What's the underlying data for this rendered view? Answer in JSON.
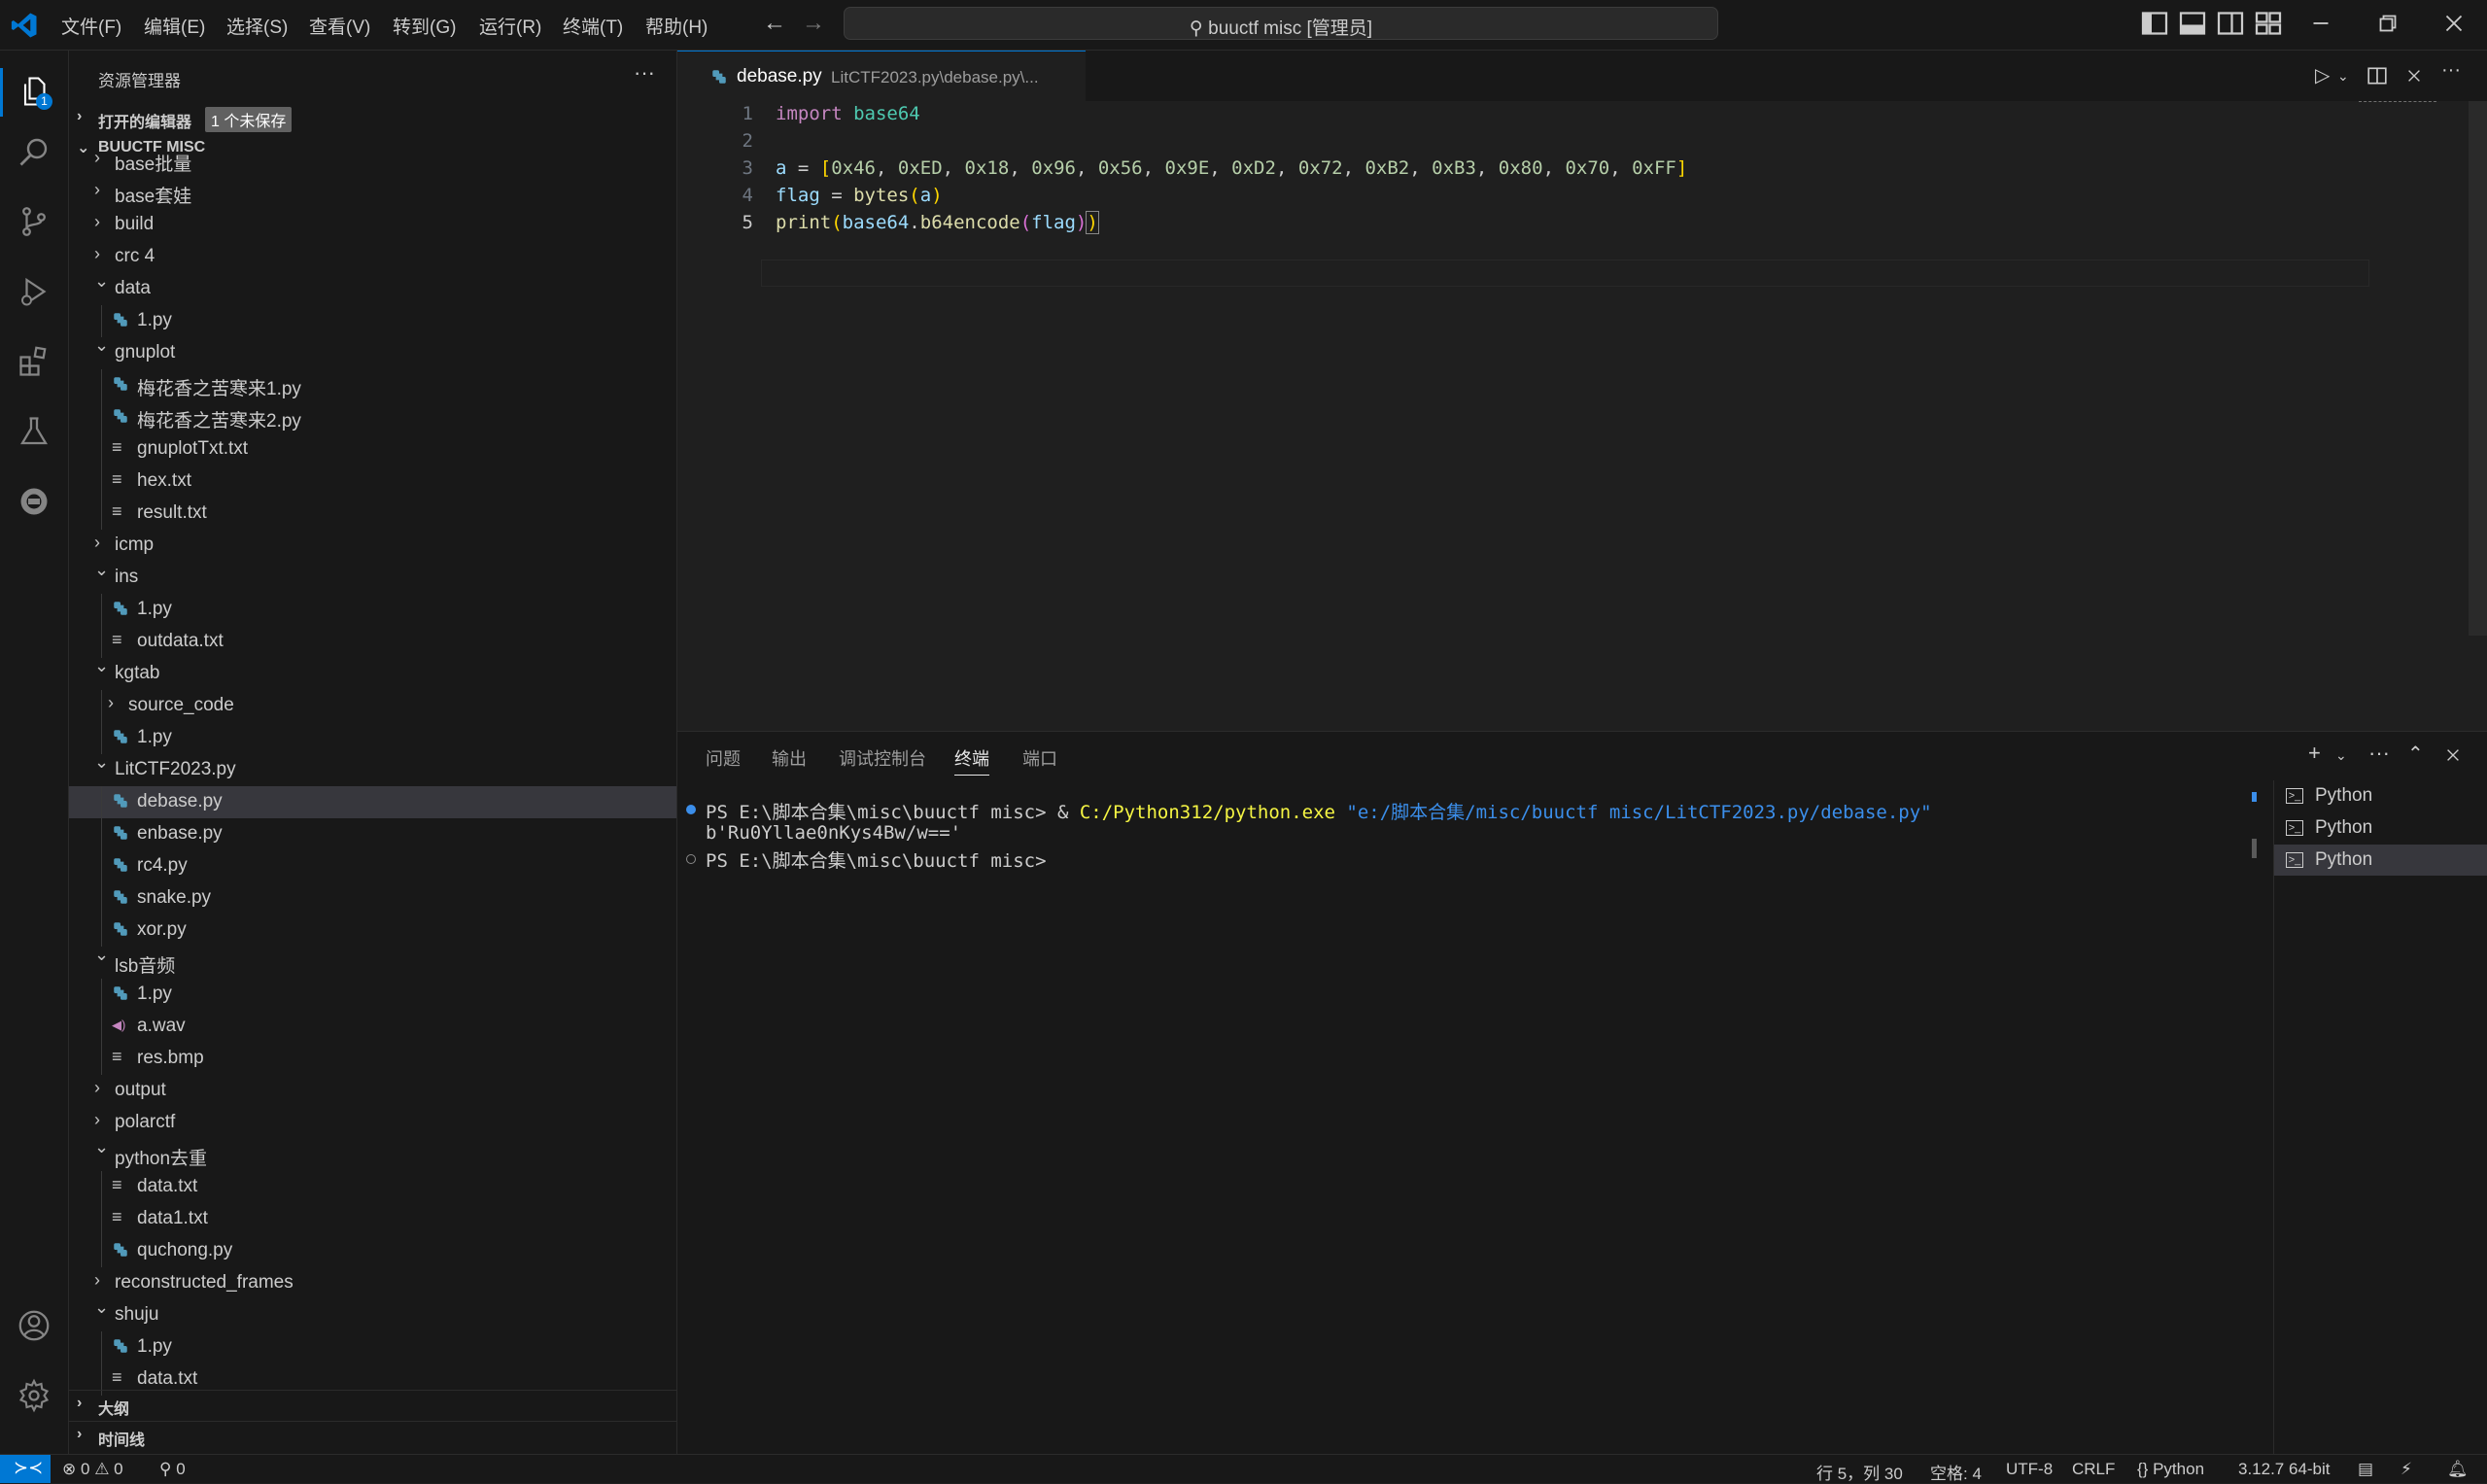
{
  "titlebar": {
    "menus": [
      "文件(F)",
      "编辑(E)",
      "选择(S)",
      "查看(V)",
      "转到(G)",
      "运行(R)",
      "终端(T)",
      "帮助(H)"
    ],
    "search_text": "buuctf misc [管理员]"
  },
  "activity": {
    "explorer_badge": "1"
  },
  "sidebar": {
    "title": "资源管理器",
    "more": "···",
    "open_editors_label": "打开的编辑器",
    "unsaved_badge": "1 个未保存",
    "folder_label": "BUUCTF MISC",
    "outline_label": "大纲",
    "timeline_label": "时间线",
    "tree": [
      {
        "name": "base批量",
        "type": "folder",
        "open": false,
        "depth": 0
      },
      {
        "name": "base套娃",
        "type": "folder",
        "open": false,
        "depth": 0
      },
      {
        "name": "build",
        "type": "folder",
        "open": false,
        "depth": 0
      },
      {
        "name": "crc 4",
        "type": "folder",
        "open": false,
        "depth": 0
      },
      {
        "name": "data",
        "type": "folder",
        "open": true,
        "depth": 0
      },
      {
        "name": "1.py",
        "type": "py",
        "depth": 1
      },
      {
        "name": "gnuplot",
        "type": "folder",
        "open": true,
        "depth": 0
      },
      {
        "name": "梅花香之苦寒来1.py",
        "type": "py",
        "depth": 1
      },
      {
        "name": "梅花香之苦寒来2.py",
        "type": "py",
        "depth": 1
      },
      {
        "name": "gnuplotTxt.txt",
        "type": "txt",
        "depth": 1
      },
      {
        "name": "hex.txt",
        "type": "txt",
        "depth": 1
      },
      {
        "name": "result.txt",
        "type": "txt",
        "depth": 1
      },
      {
        "name": "icmp",
        "type": "folder",
        "open": false,
        "depth": 0
      },
      {
        "name": "ins",
        "type": "folder",
        "open": true,
        "depth": 0
      },
      {
        "name": "1.py",
        "type": "py",
        "depth": 1
      },
      {
        "name": "outdata.txt",
        "type": "txt",
        "depth": 1
      },
      {
        "name": "kgtab",
        "type": "folder",
        "open": true,
        "depth": 0
      },
      {
        "name": "source_code",
        "type": "folder",
        "open": false,
        "depth": 1
      },
      {
        "name": "1.py",
        "type": "py",
        "depth": 1
      },
      {
        "name": "LitCTF2023.py",
        "type": "folder",
        "open": true,
        "depth": 0
      },
      {
        "name": "debase.py",
        "type": "py",
        "depth": 1,
        "selected": true
      },
      {
        "name": "enbase.py",
        "type": "py",
        "depth": 1
      },
      {
        "name": "rc4.py",
        "type": "py",
        "depth": 1
      },
      {
        "name": "snake.py",
        "type": "py",
        "depth": 1
      },
      {
        "name": "xor.py",
        "type": "py",
        "depth": 1
      },
      {
        "name": "lsb音频",
        "type": "folder",
        "open": true,
        "depth": 0
      },
      {
        "name": "1.py",
        "type": "py",
        "depth": 1
      },
      {
        "name": "a.wav",
        "type": "wav",
        "depth": 1
      },
      {
        "name": "res.bmp",
        "type": "txt",
        "depth": 1
      },
      {
        "name": "output",
        "type": "folder",
        "open": false,
        "depth": 0
      },
      {
        "name": "polarctf",
        "type": "folder",
        "open": false,
        "depth": 0
      },
      {
        "name": "python去重",
        "type": "folder",
        "open": true,
        "depth": 0
      },
      {
        "name": "data.txt",
        "type": "txt",
        "depth": 1
      },
      {
        "name": "data1.txt",
        "type": "txt",
        "depth": 1
      },
      {
        "name": "quchong.py",
        "type": "py",
        "depth": 1
      },
      {
        "name": "reconstructed_frames",
        "type": "folder",
        "open": false,
        "depth": 0
      },
      {
        "name": "shuju",
        "type": "folder",
        "open": true,
        "depth": 0
      },
      {
        "name": "1.py",
        "type": "py",
        "depth": 1
      },
      {
        "name": "data.txt",
        "type": "txt",
        "depth": 1
      }
    ]
  },
  "editor": {
    "tab_name": "debase.py",
    "tab_path": "LitCTF2023.py\\debase.py\\...",
    "line_numbers": [
      "1",
      "2",
      "3",
      "4",
      "5"
    ],
    "code": {
      "l1_kw": "import",
      "l1_mod": " base64",
      "l3_a": "a",
      "l3_eq": " = ",
      "l3_open": "[",
      "l3_nums": [
        "0x46",
        "0xED",
        "0x18",
        "0x96",
        "0x56",
        "0x9E",
        "0xD2",
        "0x72",
        "0xB2",
        "0xB3",
        "0x80",
        "0x70",
        "0xFF"
      ],
      "l3_close": "]",
      "l4_flag": "flag",
      "l4_eq": " = ",
      "l4_fn": "bytes",
      "l4_arg": "a",
      "l5_fn": "print",
      "l5_mod": "base64",
      "l5_dot": ".",
      "l5_fn2": "b64encode",
      "l5_arg": "flag"
    }
  },
  "panel": {
    "tabs": [
      "问题",
      "输出",
      "调试控制台",
      "终端",
      "端口"
    ],
    "active_tab": "终端",
    "terminal": {
      "prompt1": "PS E:\\脚本合集\\misc\\buuctf misc> & ",
      "cmd_exe": "C:/Python312/python.exe",
      "cmd_arg": " \"e:/脚本合集/misc/buuctf misc/LitCTF2023.py/debase.py\"",
      "output": "b'Ru0Yllae0nKys4Bw/w=='",
      "prompt2": "PS E:\\脚本合集\\misc\\buuctf misc> "
    },
    "terminals": [
      "Python",
      "Python",
      "Python"
    ]
  },
  "statusbar": {
    "errors": "0",
    "warnings": "0",
    "ports": "0",
    "position": "行 5，列 30",
    "spaces": "空格: 4",
    "encoding": "UTF-8",
    "eol": "CRLF",
    "language": "Python",
    "interpreter": "3.12.7 64-bit"
  },
  "colors": {
    "accent": "#0078d4",
    "keyword": "#c586c0",
    "number": "#b5cea8",
    "function": "#dcdcaa",
    "variable": "#9cdcfe",
    "python_icon": "#519aba"
  }
}
